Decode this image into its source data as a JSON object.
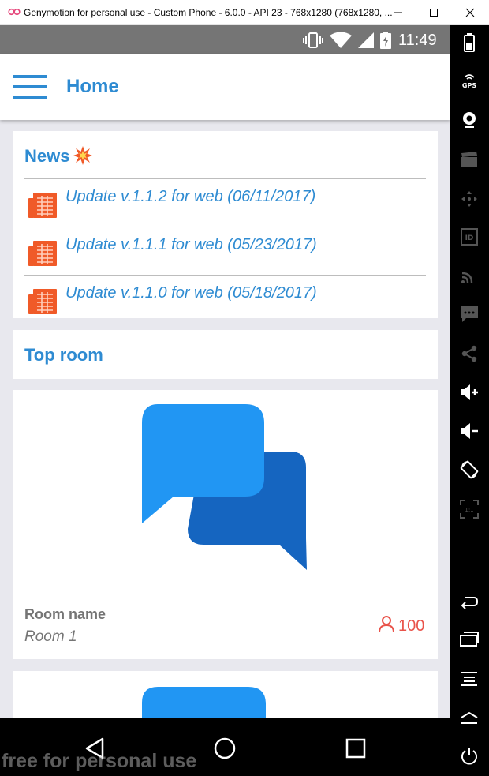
{
  "window": {
    "title": "Genymotion for personal use - Custom Phone - 6.0.0 - API 23 - 768x1280 (768x1280, ...",
    "logo_color": "#e5457a"
  },
  "status_bar": {
    "time": "11:49",
    "background": "#757575"
  },
  "app_bar": {
    "title": "Home",
    "accent_color": "#2e8bd2"
  },
  "news": {
    "title": "News",
    "badge_icon": "burst-icon",
    "items": [
      {
        "icon": "document-icon",
        "text": "Update v.1.1.2 for web (06/11/2017)"
      },
      {
        "icon": "document-icon",
        "text": "Update v.1.1.1 for web (05/23/2017)"
      },
      {
        "icon": "document-icon",
        "text": "Update v.1.1.0 for web (05/18/2017)"
      }
    ]
  },
  "top_room": {
    "title": "Top room"
  },
  "rooms": [
    {
      "image": "chat-bubbles-icon",
      "name_label": "Room name",
      "name": "Room 1",
      "members": "100"
    },
    {
      "image": "chat-bubbles-icon"
    }
  ],
  "right_toolbar": [
    "battery-icon",
    "gps-icon",
    "webcam-icon",
    "clapperboard-icon",
    "move-icon",
    "id-icon",
    "cast-icon",
    "sms-icon",
    "share-icon",
    "volume-up-icon",
    "volume-down-icon",
    "rotate-icon",
    "pixel-perfect-icon",
    "back-icon",
    "recent-apps-icon",
    "menu-icon",
    "home-icon",
    "power-icon"
  ],
  "watermark": "free for personal use",
  "colors": {
    "accent": "#2e8bd2",
    "member_count": "#e9534a",
    "news_icon": "#f05a28",
    "chat_light": "#2196f3",
    "chat_dark": "#1565c0"
  }
}
